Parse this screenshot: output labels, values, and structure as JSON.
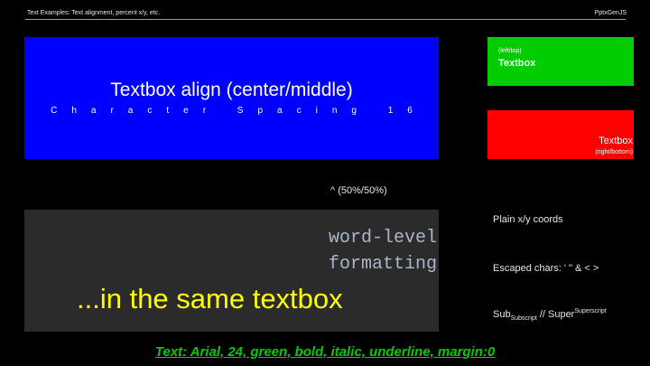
{
  "header": {
    "title": "Text Examples: Text alignment, percent x/y, etc.",
    "brand": "PptxGenJS"
  },
  "boxes": {
    "blue": {
      "main": "Textbox align (center/middle)",
      "sub": "Character Spacing 16"
    },
    "green": {
      "small": "(left/top)",
      "big": "Textbox"
    },
    "red": {
      "big": "Textbox",
      "small": "(right/bottom)"
    }
  },
  "caret_label": "^ (50%/50%)",
  "gray_box": {
    "mono_line1": "word-level",
    "mono_line2": "formatting",
    "yellow": "...in the same textbox"
  },
  "side": {
    "plain": "Plain x/y coords",
    "escaped": "Escaped chars: ' \" & < >",
    "sub_prefix": "Sub",
    "sub_text": "Subscript",
    "sup_mid": " // Super",
    "sup_text": "Superscript"
  },
  "footer": "Text: Arial, 24, green, bold, italic, underline, margin:0",
  "colors": {
    "blue": "#0000ff",
    "green": "#00cc00",
    "red": "#ff0000",
    "yellow": "#ffff00",
    "gray": "#2b2b2b"
  }
}
